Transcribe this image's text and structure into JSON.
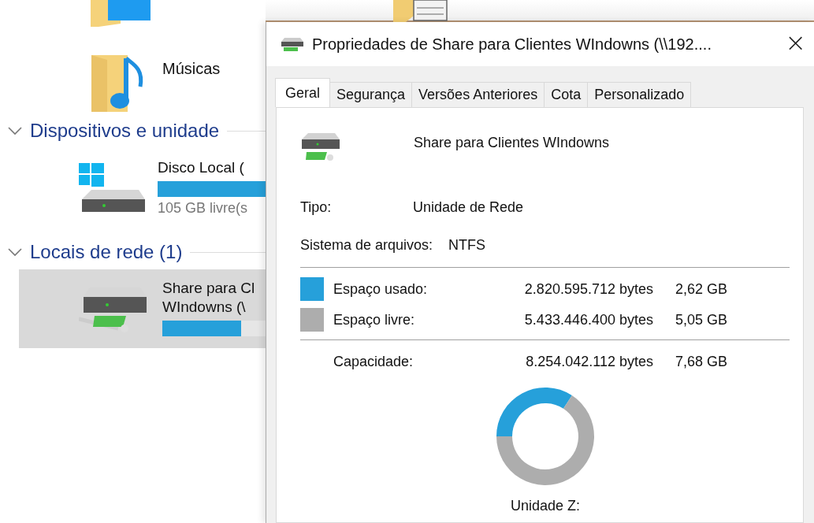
{
  "explorer": {
    "items_top": [
      {
        "name": "Músicas",
        "kind": "music"
      }
    ],
    "sections": [
      {
        "title": "Dispositivos e unidade",
        "expanded": true,
        "drives": [
          {
            "kind": "local",
            "name": "Disco Local (",
            "level": 1,
            "free": "105 GB livre(s",
            "selected": false
          }
        ]
      },
      {
        "title": "Locais de rede (1)",
        "expanded": true,
        "drives": [
          {
            "kind": "network",
            "name": "Share para Cl",
            "name2": "WIndowns (\\",
            "level": 0.76,
            "selected": true
          }
        ]
      }
    ]
  },
  "dialog": {
    "title": "Propriedades de Share para Clientes WIndowns (\\\\192....",
    "close": "×",
    "tabs": [
      {
        "label": "Geral",
        "selected": true
      },
      {
        "label": "Segurança",
        "selected": false
      },
      {
        "label": "Versões Anteriores",
        "selected": false
      },
      {
        "label": "Cota",
        "selected": false
      },
      {
        "label": "Personalizado",
        "selected": false
      }
    ],
    "name": "Share para Clientes WIndowns",
    "type_label": "Tipo:",
    "type_value": "Unidade de Rede",
    "fs_label": "Sistema de arquivos:",
    "fs_value": "NTFS",
    "space": [
      {
        "label": "Espaço usado:",
        "bytes": "2.820.595.712 bytes",
        "size": "2,62 GB",
        "color": "#26a0da"
      },
      {
        "label": "Espaço livre:",
        "bytes": "5.433.446.400 bytes",
        "size": "5,05 GB",
        "color": "#adadad"
      }
    ],
    "capacity": {
      "label": "Capacidade:",
      "bytes": "8.254.042.112 bytes",
      "size": "7,68 GB"
    },
    "chart_data": {
      "type": "donut",
      "values": [
        34.2,
        65.8
      ]
    },
    "drive_label": "Unidade Z:"
  }
}
